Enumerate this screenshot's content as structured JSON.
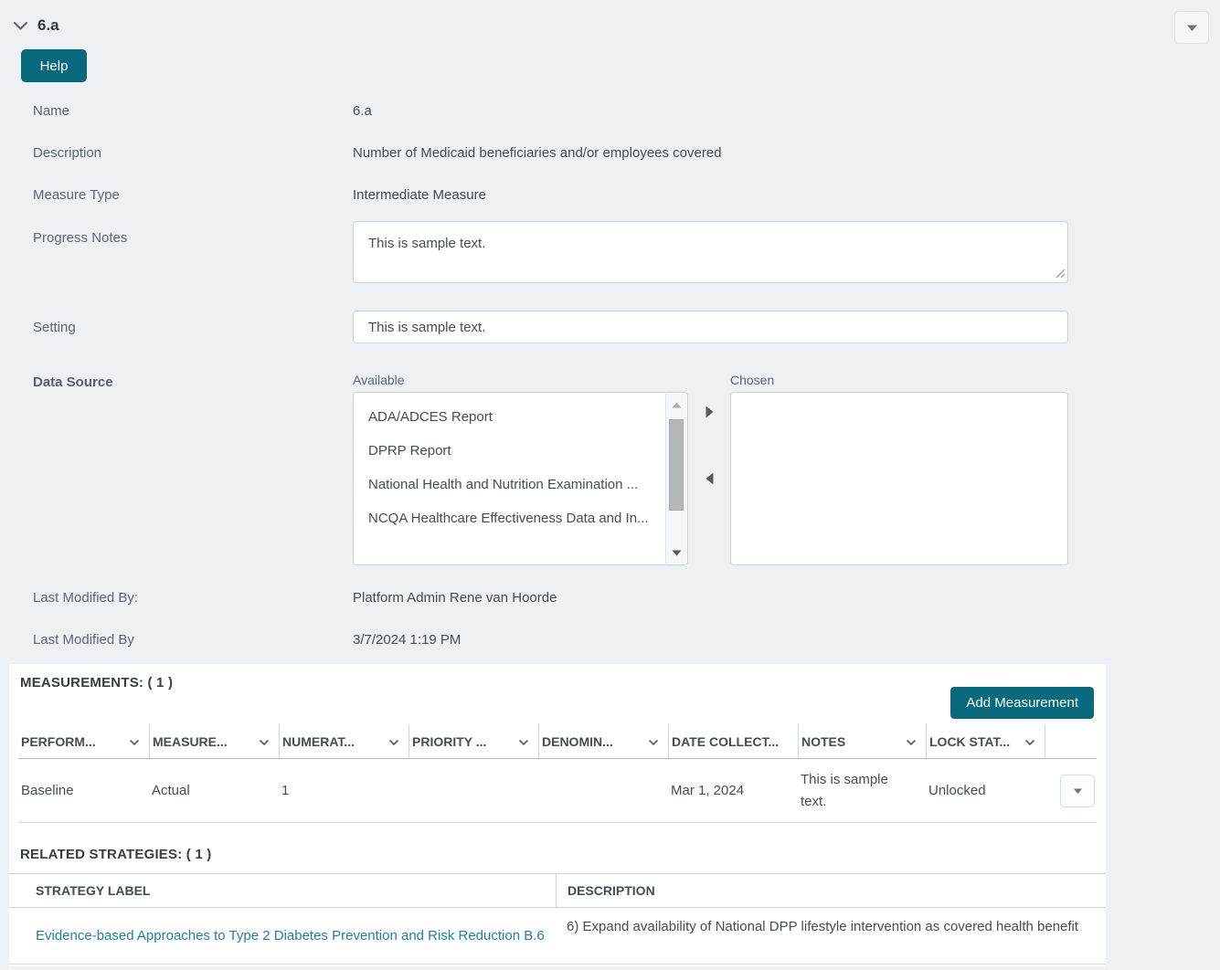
{
  "colors": {
    "accent": "#086a7c",
    "link": "#217ea2"
  },
  "header": {
    "title": "6.a",
    "help_label": "Help"
  },
  "form": {
    "name": {
      "label": "Name",
      "value": "6.a"
    },
    "description": {
      "label": "Description",
      "value": "Number of Medicaid beneficiaries and/or employees covered"
    },
    "measure_type": {
      "label": "Measure Type",
      "value": "Intermediate Measure"
    },
    "progress_notes": {
      "label": "Progress Notes",
      "value": "This is sample text."
    },
    "setting": {
      "label": "Setting",
      "value": "This is sample text."
    },
    "data_source": {
      "label": "Data Source",
      "available_label": "Available",
      "chosen_label": "Chosen",
      "available_items": [
        "ADA/ADCES Report",
        "DPRP Report",
        "National Health and Nutrition Examination ...",
        "NCQA Healthcare Effectiveness Data and In..."
      ],
      "chosen_items": []
    },
    "last_modified_by": {
      "label": "Last Modified By:",
      "value": "Platform Admin Rene van Hoorde"
    },
    "last_modified_date": {
      "label": "Last Modified By",
      "value": "3/7/2024 1:19 PM"
    }
  },
  "measurements": {
    "title": "MEASUREMENTS: ( 1 )",
    "add_button_label": "Add Measurement",
    "columns": [
      {
        "label": "PERFORM..."
      },
      {
        "label": "MEASURE..."
      },
      {
        "label": "NUMERAT..."
      },
      {
        "label": "PRIORITY ..."
      },
      {
        "label": "DENOMIN..."
      },
      {
        "label": "DATE COLLECT..."
      },
      {
        "label": "NOTES"
      },
      {
        "label": "LOCK STAT..."
      }
    ],
    "rows": [
      {
        "performance": "Baseline",
        "measure": "Actual",
        "numerator": "1",
        "priority": "",
        "denominator": "",
        "date_collected": "Mar 1, 2024",
        "notes": "This is sample text.",
        "lock_status": "Unlocked"
      }
    ]
  },
  "related_strategies": {
    "title": "RELATED STRATEGIES: ( 1 )",
    "columns": {
      "label": "STRATEGY LABEL",
      "description": "DESCRIPTION"
    },
    "rows": [
      {
        "label": "Evidence-based Approaches to Type 2 Diabetes Prevention and Risk Reduction B.6",
        "description": "6) Expand availability of National DPP lifestyle intervention as covered health benefit"
      }
    ]
  }
}
